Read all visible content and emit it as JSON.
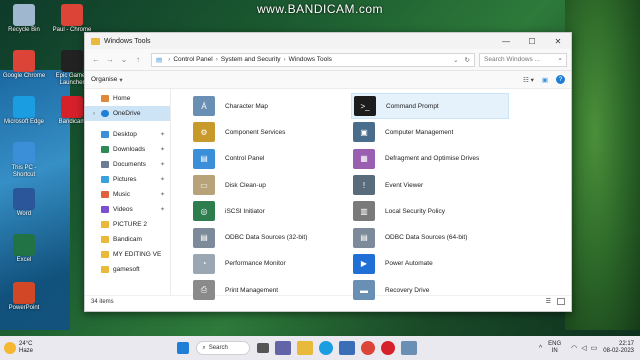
{
  "watermark": "www.BANDICAM.com",
  "desktop": [
    {
      "label": "Recycle Bin",
      "icon": "recycle-bin-icon",
      "color": "#9fb7cf"
    },
    {
      "label": "Paul - Chrome",
      "icon": "chrome-icon",
      "color": "#db4437"
    },
    {
      "label": "Google Chrome",
      "icon": "chrome-icon",
      "color": "#db4437"
    },
    {
      "label": "Epic Games Launcher",
      "icon": "epic-games-icon",
      "color": "#222222"
    },
    {
      "label": "Microsoft Edge",
      "icon": "edge-icon",
      "color": "#1b9de2"
    },
    {
      "label": "Bandicam",
      "icon": "bandicam-icon",
      "color": "#d6202a"
    },
    {
      "label": "This PC - Shortcut",
      "icon": "this-pc-icon",
      "color": "#3a8fd8"
    },
    {
      "label": "Word",
      "icon": "word-icon",
      "color": "#2b579a"
    },
    {
      "label": "Excel",
      "icon": "excel-icon",
      "color": "#217346"
    },
    {
      "label": "PowerPoint",
      "icon": "powerpoint-icon",
      "color": "#d24726"
    }
  ],
  "window": {
    "title": "Windows Tools",
    "minimize": "—",
    "maximize": "☐",
    "close": "✕",
    "breadcrumb": [
      "Control Panel",
      "System and Security",
      "Windows Tools"
    ],
    "search_placeholder": "Search Windows ...",
    "organise": "Organise",
    "status": "34 items"
  },
  "nav": {
    "home": "Home",
    "onedrive": "OneDrive",
    "folders": [
      {
        "label": "Desktop",
        "color": "#3a8fd8",
        "pinned": true
      },
      {
        "label": "Downloads",
        "color": "#2e8b57",
        "pinned": true
      },
      {
        "label": "Documents",
        "color": "#6b7c93",
        "pinned": true
      },
      {
        "label": "Pictures",
        "color": "#3aa0e0",
        "pinned": true
      },
      {
        "label": "Music",
        "color": "#e0603a",
        "pinned": true
      },
      {
        "label": "Videos",
        "color": "#7b4fd1",
        "pinned": true
      },
      {
        "label": "PICTURE 2",
        "color": "#e8b93a",
        "pinned": false
      },
      {
        "label": "Bandicam",
        "color": "#e8b93a",
        "pinned": false
      },
      {
        "label": "MY EDITING VE",
        "color": "#e8b93a",
        "pinned": false
      },
      {
        "label": "gamesoft",
        "color": "#e8b93a",
        "pinned": false
      }
    ]
  },
  "tools": [
    {
      "label": "Character Map",
      "color": "#6a8fb5",
      "glyph": "Á"
    },
    {
      "label": "Command Prompt",
      "color": "#1c1c1c",
      "glyph": ">_"
    },
    {
      "label": "Component Services",
      "color": "#c79a2b",
      "glyph": "⚙"
    },
    {
      "label": "Computer Management",
      "color": "#4a6d8c",
      "glyph": "▣"
    },
    {
      "label": "Control Panel",
      "color": "#3a8fd8",
      "glyph": "▤"
    },
    {
      "label": "Defragment and Optimise Drives",
      "color": "#9a5fb0",
      "glyph": "▦"
    },
    {
      "label": "Disk Clean-up",
      "color": "#b8a27a",
      "glyph": "▭"
    },
    {
      "label": "Event Viewer",
      "color": "#5a6b7c",
      "glyph": "!"
    },
    {
      "label": "iSCSI Initiator",
      "color": "#2e7d4f",
      "glyph": "◎"
    },
    {
      "label": "Local Security Policy",
      "color": "#7a7a7a",
      "glyph": "▥"
    },
    {
      "label": "ODBC Data Sources (32-bit)",
      "color": "#7d8a99",
      "glyph": "▤"
    },
    {
      "label": "ODBC Data Sources (64-bit)",
      "color": "#7d8a99",
      "glyph": "▤"
    },
    {
      "label": "Performance Monitor",
      "color": "#9aa6b2",
      "glyph": "◔"
    },
    {
      "label": "Power Automate",
      "color": "#1f6fd6",
      "glyph": "▶"
    },
    {
      "label": "Print Management",
      "color": "#8a8a8a",
      "glyph": "⎙"
    },
    {
      "label": "Recovery Drive",
      "color": "#6a8fb5",
      "glyph": "▬"
    }
  ],
  "taskbar": {
    "temp": "24°C",
    "condition": "Haze",
    "search": "Search",
    "lang1": "ENG",
    "lang2": "IN",
    "time": "22:17",
    "date": "08-02-2023"
  }
}
